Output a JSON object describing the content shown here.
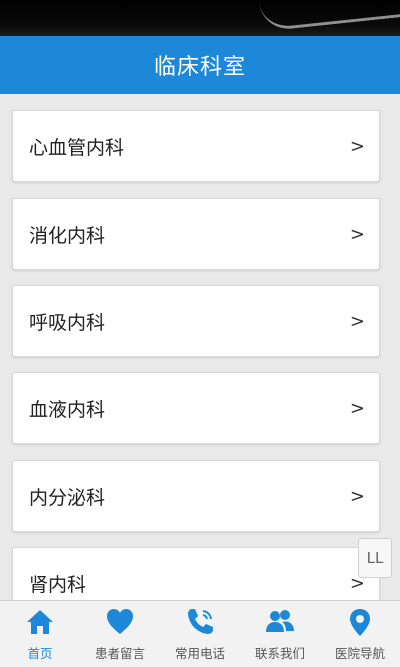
{
  "header": {
    "title": "临床科室"
  },
  "departments": [
    {
      "label": "心血管内科"
    },
    {
      "label": "消化内科"
    },
    {
      "label": "呼吸内科"
    },
    {
      "label": "血液内科"
    },
    {
      "label": "内分泌科"
    },
    {
      "label": "肾内科"
    }
  ],
  "chevron": ">",
  "scroll_button": {
    "label": "LL"
  },
  "tabs": [
    {
      "label": "首页",
      "icon": "home-icon",
      "active": true
    },
    {
      "label": "患者留言",
      "icon": "heart-icon",
      "active": false
    },
    {
      "label": "常用电话",
      "icon": "phone-icon",
      "active": false
    },
    {
      "label": "联系我们",
      "icon": "people-icon",
      "active": false
    },
    {
      "label": "医院导航",
      "icon": "location-pin-icon",
      "active": false
    }
  ],
  "colors": {
    "accent": "#1e88d8",
    "background": "#e9e9e9",
    "card": "#ffffff"
  }
}
